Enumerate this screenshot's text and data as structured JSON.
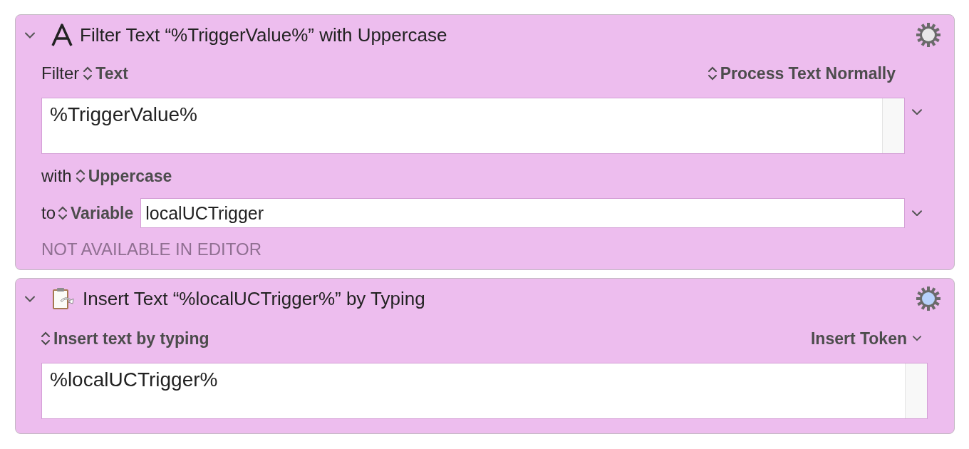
{
  "actions": [
    {
      "kind": "filter",
      "title": "Filter Text “%TriggerValue%” with Uppercase",
      "expanded": true,
      "settings_highlighted": false,
      "filter_label": "Filter",
      "source": "Text",
      "mode": "Process Text Normally",
      "text_value": "%TriggerValue%",
      "with_label": "with",
      "filter_value": "Uppercase",
      "to_label": "to",
      "destination": "Variable",
      "variable_value": "localUCTrigger",
      "note": "NOT AVAILABLE IN EDITOR"
    },
    {
      "kind": "insert",
      "title": "Insert Text “%localUCTrigger%” by Typing",
      "expanded": true,
      "settings_highlighted": true,
      "method": "Insert text by typing",
      "token_button": "Insert Token",
      "text_value": "%localUCTrigger%"
    }
  ]
}
